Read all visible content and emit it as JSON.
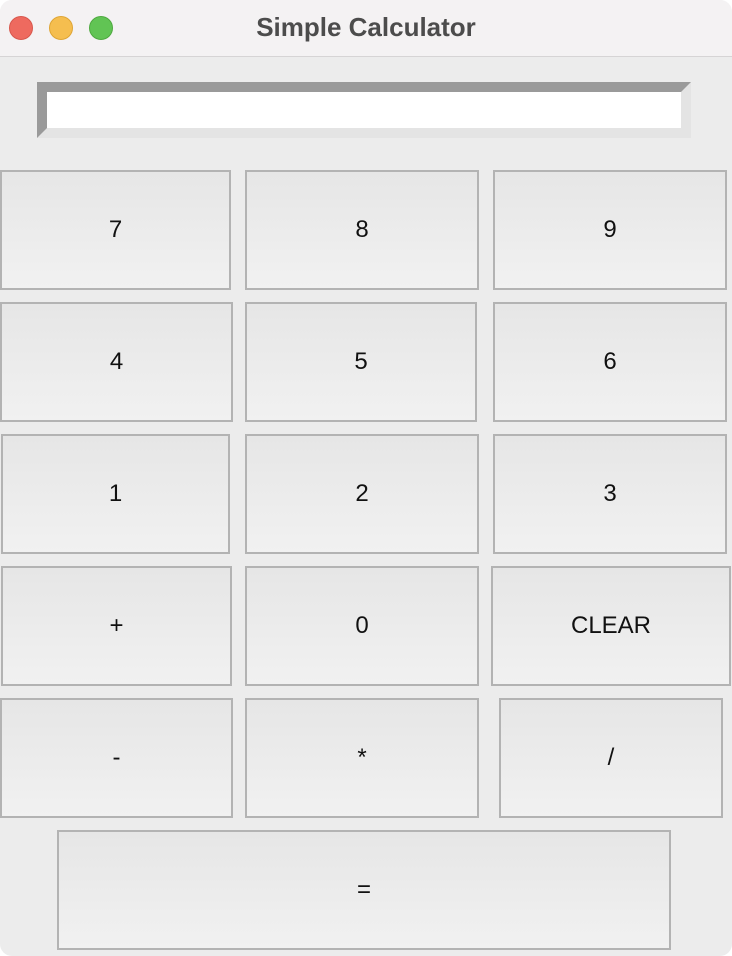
{
  "window": {
    "title": "Simple Calculator"
  },
  "display": {
    "value": ""
  },
  "keys": {
    "k7": "7",
    "k8": "8",
    "k9": "9",
    "k4": "4",
    "k5": "5",
    "k6": "6",
    "k1": "1",
    "k2": "2",
    "k3": "3",
    "plus": "+",
    "k0": "0",
    "clear": "CLEAR",
    "minus": "-",
    "multiply": "*",
    "divide": "/",
    "equals": "="
  }
}
